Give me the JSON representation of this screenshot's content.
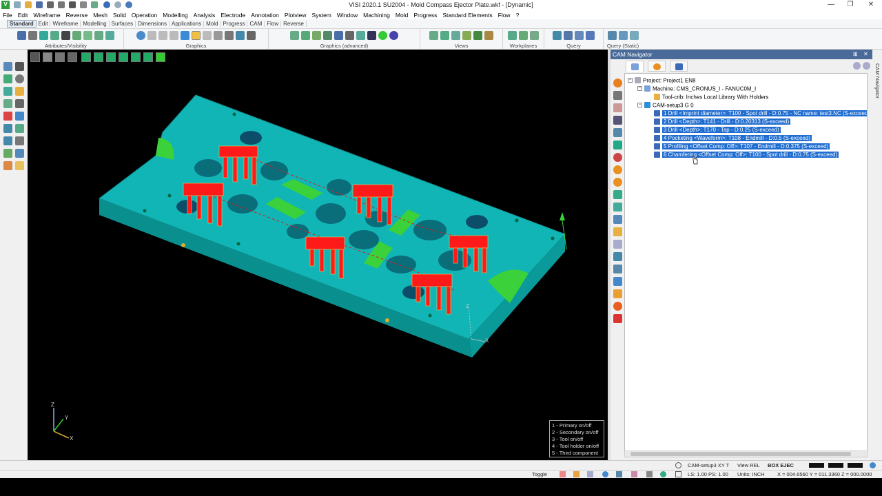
{
  "window": {
    "title": "VISI 2020.1 SU2004 - Mold Compass Ejector Plate.wkf - [Dynamic]",
    "logo": "V",
    "min": "—",
    "max": "❐",
    "close": "✕"
  },
  "menu": [
    "File",
    "Edit",
    "Wireframe",
    "Reverse",
    "Mesh",
    "Solid",
    "Operation",
    "Modelling",
    "Analysis",
    "Electrode",
    "Annotation",
    "Plotview",
    "System",
    "Window",
    "Machining",
    "Mold",
    "Progress",
    "Standard Elements",
    "Flow",
    "?"
  ],
  "tabs": [
    "Standard",
    "Edit",
    "Wireframe",
    "Modelling",
    "Surfaces",
    "Dimensions",
    "Applications",
    "Mold",
    "Progress",
    "CAM",
    "Flow",
    "Reverse"
  ],
  "active_tab": "Standard",
  "ribbon_groups": [
    "Attributes/Visibility",
    "Graphics",
    "Graphics (advanced)",
    "Views",
    "Workplanes",
    "Query",
    "Query (Static)"
  ],
  "legend": [
    "1 - Primary on/off",
    "2 - Secondary on/off",
    "3 - Tool on/off",
    "4 - Tool holder on/off",
    "5 - Third component"
  ],
  "axes": {
    "x": "X",
    "y": "Y",
    "z": "Z"
  },
  "panel": {
    "title": "CAM Navigator",
    "side_tab": "CAM Navigator",
    "pin": "⊞",
    "close": "✕"
  },
  "tree": [
    {
      "label": "Project: Project1 EN8",
      "level": 0,
      "expander": "−",
      "selected": false
    },
    {
      "label": "Machine: CMS_CRONUS_I - FANUC0M_I",
      "level": 1,
      "expander": "−",
      "selected": false
    },
    {
      "label": "Tool-crib: Inches Local Library With Holders",
      "level": 2,
      "expander": "",
      "selected": false
    },
    {
      "label": "CAM-setup3 G 0",
      "level": 1,
      "expander": "−",
      "selected": false
    },
    {
      "label": "1 Drill <Imprint diameter>: T100 - Spot drill - D:0.75 - NC name: test3.NC (S-exceed)",
      "level": 2,
      "expander": "",
      "selected": true
    },
    {
      "label": "2 Drill <Depth>: T141 - Drill - D:0.20313 (S-exceed)",
      "level": 2,
      "expander": "",
      "selected": true
    },
    {
      "label": "3 Drill <Depth>: T170 - Tap - D:0.25 (S-exceed)",
      "level": 2,
      "expander": "",
      "selected": true
    },
    {
      "label": "4 Pocketing <Waveform>: T108 - Endmill - D:0.5 (S-exceed)",
      "level": 2,
      "expander": "",
      "selected": true
    },
    {
      "label": "5 Profiling <Offset Comp: Off>: T107 - Endmill - D:0.375 (S-exceed)",
      "level": 2,
      "expander": "",
      "selected": true
    },
    {
      "label": "6 Chamfering <Offset Comp: Off>: T100 - Spot drill - D:0.75 (S-exceed)",
      "level": 2,
      "expander": "",
      "selected": true
    }
  ],
  "status": {
    "setup": "CAM-setup3 XY T",
    "view": "View REL",
    "box": "BOX EJEC",
    "toggle": "Toggle",
    "ls_ps": "LS: 1.00 PS: 1.00",
    "units": "Units: INCH",
    "coords": "X = 004.6560 Y = 011.3360 Z = 000.0000"
  },
  "colors": {
    "plate": "#12b5b5",
    "pocket": "#3ad13a",
    "tool": "#ff1a1a",
    "selection": "#1f6dd1",
    "panel_header": "#4a6b9a"
  }
}
